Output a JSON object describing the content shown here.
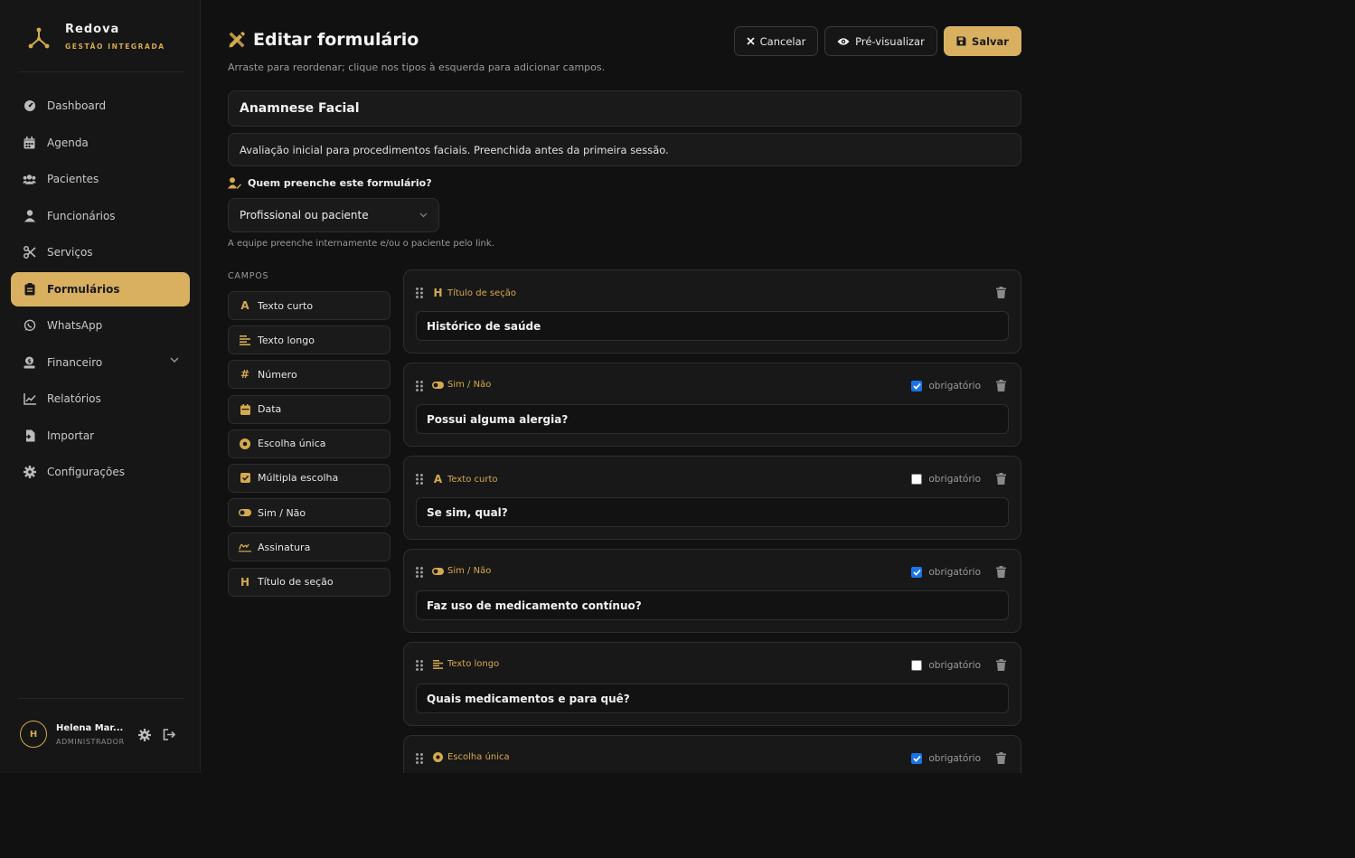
{
  "brand": {
    "name": "Redova",
    "subtitle": "GESTÃO INTEGRADA"
  },
  "sidebar": {
    "items": [
      {
        "label": "Dashboard",
        "icon": "dashboard-icon",
        "active": false
      },
      {
        "label": "Agenda",
        "icon": "calendar-icon",
        "active": false
      },
      {
        "label": "Pacientes",
        "icon": "users-icon",
        "active": false
      },
      {
        "label": "Funcionários",
        "icon": "user-icon",
        "active": false
      },
      {
        "label": "Serviços",
        "icon": "scissors-icon",
        "active": false
      },
      {
        "label": "Formulários",
        "icon": "clipboard-icon",
        "active": true
      },
      {
        "label": "WhatsApp",
        "icon": "whatsapp-icon",
        "active": false
      },
      {
        "label": "Financeiro",
        "icon": "money-icon",
        "active": false,
        "expandable": true
      },
      {
        "label": "Relatórios",
        "icon": "chart-icon",
        "active": false
      },
      {
        "label": "Importar",
        "icon": "import-icon",
        "active": false
      },
      {
        "label": "Configurações",
        "icon": "gear-icon",
        "active": false
      }
    ]
  },
  "user": {
    "initial": "H",
    "name": "Helena Mar...",
    "role": "ADMINISTRADOR"
  },
  "header": {
    "title": "Editar formulário",
    "subtitle": "Arraste para reordenar; clique nos tipos à esquerda para adicionar campos.",
    "cancel_label": "Cancelar",
    "preview_label": "Pré-visualizar",
    "save_label": "Salvar"
  },
  "form": {
    "name": "Anamnese Facial",
    "description": "Avaliação inicial para procedimentos faciais. Preenchida antes da primeira sessão.",
    "who_label": "Quem preenche este formulário?",
    "who_value": "Profissional ou paciente",
    "who_help": "A equipe preenche internamente e/ou o paciente pelo link."
  },
  "palette": {
    "heading": "CAMPOS",
    "items": [
      {
        "label": "Texto curto",
        "icon": "A"
      },
      {
        "label": "Texto longo",
        "icon": "≡"
      },
      {
        "label": "Número",
        "icon": "#"
      },
      {
        "label": "Data",
        "icon": "date"
      },
      {
        "label": "Escolha única",
        "icon": "radio"
      },
      {
        "label": "Múltipla escolha",
        "icon": "check"
      },
      {
        "label": "Sim / Não",
        "icon": "toggle"
      },
      {
        "label": "Assinatura",
        "icon": "signature"
      },
      {
        "label": "Título de seção",
        "icon": "H"
      }
    ]
  },
  "required_label": "obrigatório",
  "fields": [
    {
      "type": "Título de seção",
      "icon": "H",
      "label": "Histórico de saúde",
      "show_required": false,
      "required": false
    },
    {
      "type": "Sim / Não",
      "icon": "toggle",
      "label": "Possui alguma alergia?",
      "show_required": true,
      "required": true
    },
    {
      "type": "Texto curto",
      "icon": "A",
      "label": "Se sim, qual?",
      "show_required": true,
      "required": false
    },
    {
      "type": "Sim / Não",
      "icon": "toggle",
      "label": "Faz uso de medicamento contínuo?",
      "show_required": true,
      "required": true
    },
    {
      "type": "Texto longo",
      "icon": "≡",
      "label": "Quais medicamentos e para quê?",
      "show_required": true,
      "required": false
    },
    {
      "type": "Escolha única",
      "icon": "radio",
      "label": "",
      "show_required": true,
      "required": true
    }
  ],
  "colors": {
    "accent": "#d8b060",
    "background": "#111111",
    "checkbox": "#1a73e8"
  }
}
